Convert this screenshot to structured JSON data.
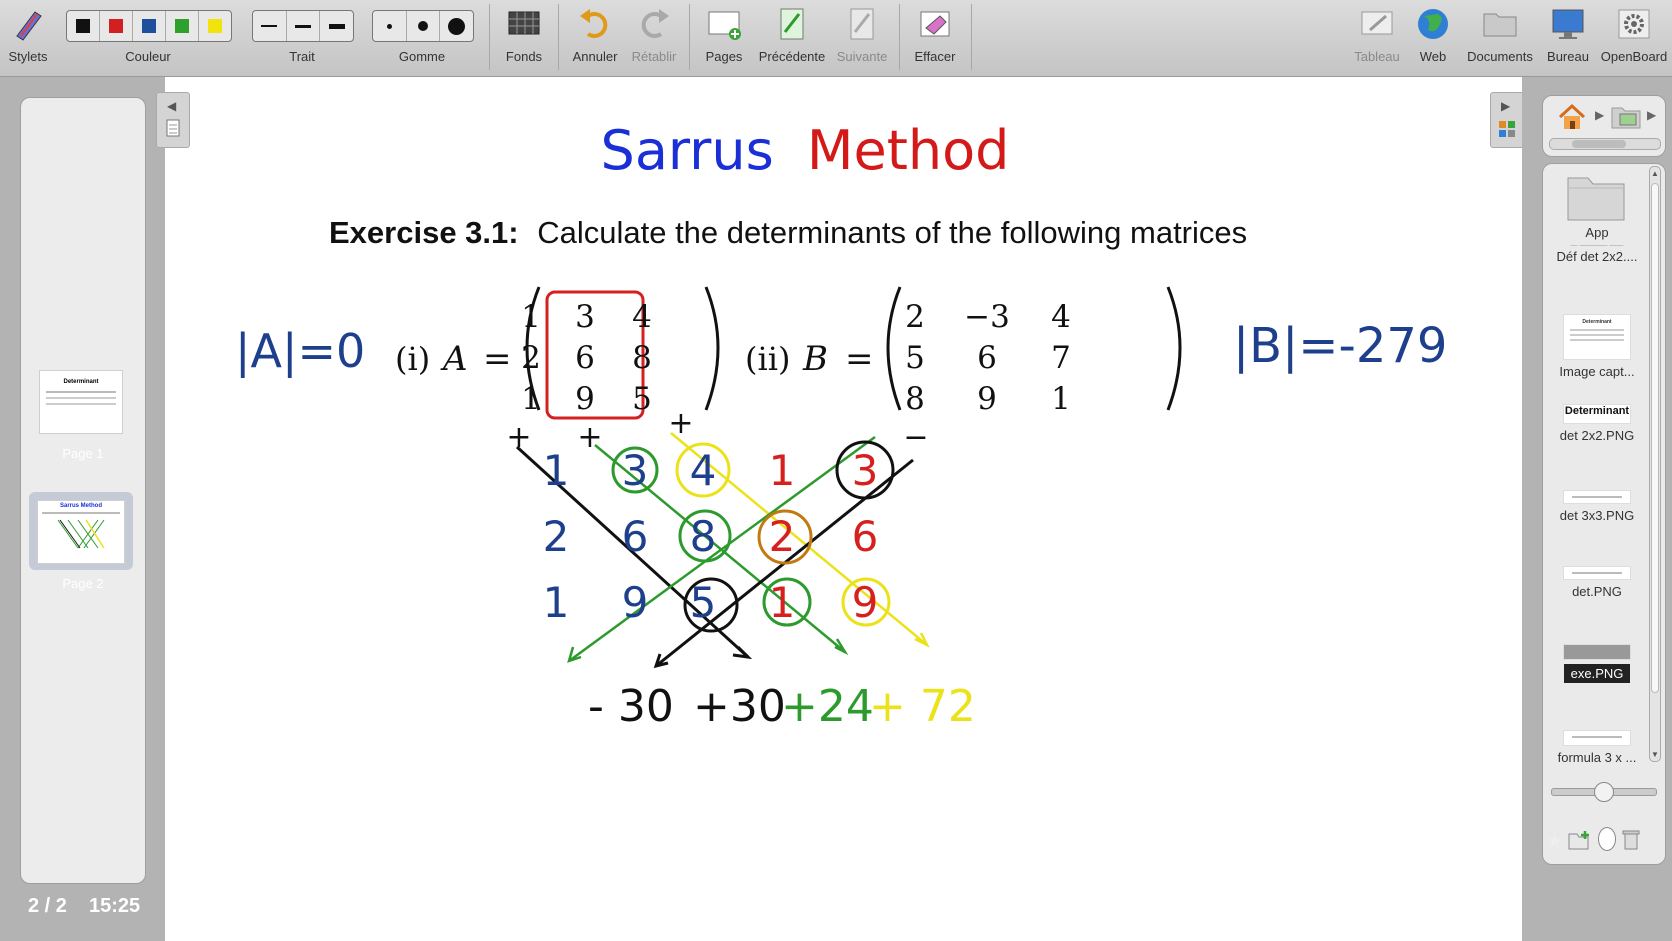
{
  "toolbar": {
    "stylets": "Stylets",
    "couleur": "Couleur",
    "trait": "Trait",
    "gomme": "Gomme",
    "fonds": "Fonds",
    "annuler": "Annuler",
    "retablir": "Rétablir",
    "pages": "Pages",
    "precedente": "Précédente",
    "suivante": "Suivante",
    "effacer": "Effacer",
    "tableau": "Tableau",
    "web": "Web",
    "documents": "Documents",
    "bureau": "Bureau",
    "openboard": "OpenBoard",
    "colors": [
      "#111111",
      "#d21f1f",
      "#1c4f9c",
      "#2ea02e",
      "#f2e30c"
    ]
  },
  "pages_panel": {
    "page1": "Page 1",
    "page2": "Page 2",
    "counter": "2 / 2",
    "clock": "15:25",
    "thumb1_title": "Determinant",
    "thumb2_title": "Sarrus Method"
  },
  "board": {
    "title_part1": "Sarrus",
    "title_part2": "Method",
    "exercise_label": "Exercise 3.1:",
    "exercise_text": "Calculate the determinants of the following matrices",
    "det_a": "|A|=0",
    "det_b": "|B|=-279",
    "matrix_a_label": "(i)",
    "matrix_a_name": "A",
    "matrix_b_label": "(ii)",
    "matrix_b_name": "B",
    "equals": "=",
    "matrix_a": [
      [
        "1",
        "3",
        "4"
      ],
      [
        "2",
        "6",
        "8"
      ],
      [
        "1",
        "9",
        "5"
      ]
    ],
    "matrix_b": [
      [
        "2",
        "−3",
        "4"
      ],
      [
        "5",
        "6",
        "7"
      ],
      [
        "8",
        "9",
        "1"
      ]
    ],
    "sarrus_grid": [
      [
        "1",
        "3",
        "4",
        "1",
        "3"
      ],
      [
        "2",
        "6",
        "8",
        "2",
        "6"
      ],
      [
        "1",
        "9",
        "5",
        "1",
        "9"
      ]
    ],
    "signs": [
      "+",
      "+",
      "+",
      "−"
    ],
    "terms": [
      "- 30",
      "+30",
      "+24",
      "+ 72"
    ]
  },
  "library": {
    "items": [
      {
        "name": "App",
        "sub": "Déf det 2x2...."
      },
      {
        "name": "Image capt...",
        "sub": ""
      },
      {
        "name": "det 2x2.PNG",
        "sub": "Determinant"
      },
      {
        "name": "det 3x3.PNG",
        "sub": ""
      },
      {
        "name": "det.PNG",
        "sub": ""
      },
      {
        "name": "exe.PNG",
        "sub": ""
      },
      {
        "name": "formula 3 x ...",
        "sub": ""
      }
    ]
  },
  "colors": {
    "blue": "#1a2fd6",
    "red": "#d41919",
    "ink_blue": "#1d3f8c",
    "green": "#2c9a2c",
    "yellow": "#ece21a",
    "ink_red": "#d62020"
  }
}
